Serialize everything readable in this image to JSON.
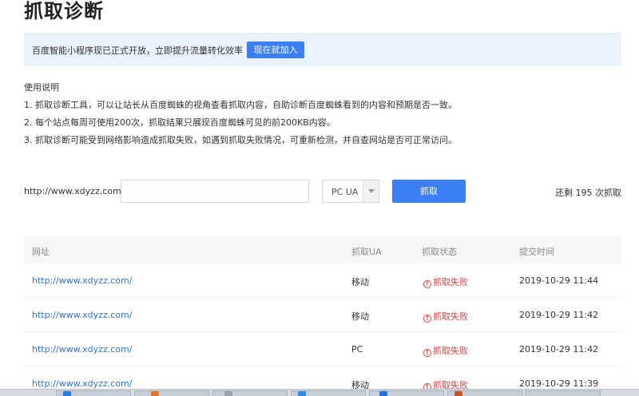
{
  "page": {
    "title": "抓取诊断"
  },
  "notice": {
    "text": "百度智能小程序现已正式开放，立即提升流量转化效率",
    "button_label": "现在就加入"
  },
  "instructions": [
    "使用说明",
    "1. 抓取诊断工具，可以让站长从百度蜘蛛的视角查看抓取内容，自助诊断百度蜘蛛看到的内容和预期是否一致。",
    "2. 每个站点每周可使用200次，抓取结果只展现百度蜘蛛可见的前200KB内容。",
    "3. 抓取诊断可能受到网络影响造成抓取失败，如遇到抓取失败情况，可重新检测，并自查网站是否可正常访问。"
  ],
  "form": {
    "url_prefix": "http://www.xdyzz.com/",
    "url_input_value": "",
    "ua_selected": "PC UA",
    "fetch_button_label": "抓取",
    "remaining_text": "还剩 195 次抓取"
  },
  "table": {
    "columns": [
      "网址",
      "抓取UA",
      "抓取状态",
      "提交时间"
    ],
    "rows": [
      {
        "url": "http://www.xdyzz.com/",
        "ua": "移动",
        "status": "抓取失败",
        "time": "2019-10-29 11:44"
      },
      {
        "url": "http://www.xdyzz.com/",
        "ua": "移动",
        "status": "抓取失败",
        "time": "2019-10-29 11:42"
      },
      {
        "url": "http://www.xdyzz.com/",
        "ua": "PC",
        "status": "抓取失败",
        "time": "2019-10-29 11:42"
      },
      {
        "url": "http://www.xdyzz.com/",
        "ua": "移动",
        "status": "抓取失败",
        "time": "2019-10-29 11:39"
      }
    ]
  },
  "colors": {
    "accent": "#3a7ff5",
    "notice_bg": "#eaf2fd",
    "fail": "#e04040",
    "link": "#2f6fe0"
  },
  "icons": {
    "fail_status": "exclamation-circle-icon",
    "dropdown": "chevron-down-icon"
  }
}
